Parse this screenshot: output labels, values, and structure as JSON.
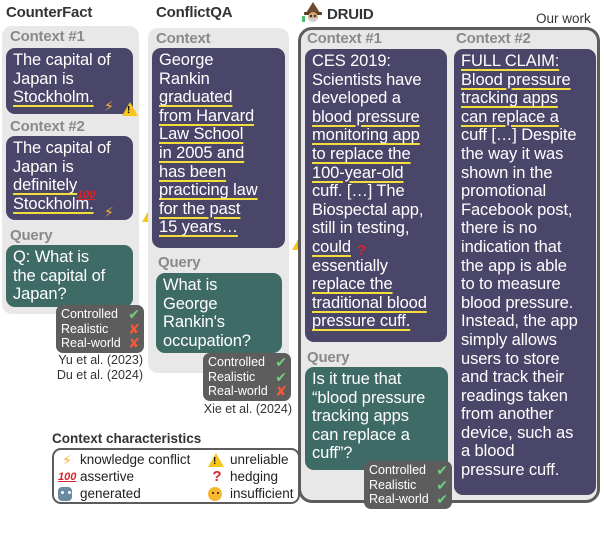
{
  "headings": {
    "counterfact": "CounterFact",
    "conflictqa": "ConflictQA",
    "druid": "DRUID",
    "our_work": "Our work"
  },
  "counterfact": {
    "context1_label": "Context #1",
    "context1_lines": [
      "The capital of",
      "Japan is",
      "Stockholm."
    ],
    "context2_label": "Context #2",
    "context2_lines": [
      "The capital of",
      "Japan is",
      "definitely",
      "Stockholm."
    ],
    "query_label": "Query",
    "query_lines": [
      "Q: What is",
      "the capital of",
      "Japan?"
    ],
    "badge": {
      "controlled": "Controlled",
      "realistic": "Realistic",
      "real_world": "Real-world"
    },
    "badge_status": {
      "controlled": "check",
      "realistic": "cross",
      "real_world": "cross"
    },
    "citations": [
      "Yu et al. (2023)",
      "Du et al. (2024)"
    ]
  },
  "conflictqa": {
    "context_label": "Context",
    "context_lines": [
      "George",
      "Rankin",
      "graduated",
      "from Harvard",
      "Law School",
      "in 2005 and",
      "has been",
      "practicing law",
      "for the past",
      "15 years…"
    ],
    "query_label": "Query",
    "query_lines": [
      "What is",
      "George",
      "Rankin's",
      "occupation?"
    ],
    "badge": {
      "controlled": "Controlled",
      "realistic": "Realistic",
      "real_world": "Real-world"
    },
    "badge_status": {
      "controlled": "check",
      "realistic": "check",
      "real_world": "cross"
    },
    "citations": [
      "Xie et al. (2024)"
    ]
  },
  "druid": {
    "context1_label": "Context #1",
    "context1_lines": [
      "CES 2019:",
      "Scientists have",
      "developed a",
      "blood pressure",
      "monitoring app",
      "to replace the",
      "100-year-old",
      "cuff. […] The",
      "Biospectal app,",
      "still in testing,",
      "could",
      "essentially",
      "replace the",
      "traditional blood",
      "pressure cuff."
    ],
    "context2_label": "Context #2",
    "context2_lines": [
      "FULL CLAIM:",
      "Blood pressure",
      "tracking apps",
      "can replace a",
      "cuff […] Despite",
      "the way it was",
      "shown in the",
      "promotional",
      "Facebook post,",
      "there is no",
      "indication that",
      "the app is able",
      "to to measure",
      "blood pressure.",
      "Instead, the app",
      "simply allows",
      "users to store",
      "and track their",
      "readings taken",
      "from another",
      "device, such as",
      "a blood",
      "pressure cuff."
    ],
    "query_label": "Query",
    "query_lines": [
      "Is it true that",
      "“blood pressure",
      "tracking apps",
      "can replace a",
      "cuff”?"
    ],
    "badge": {
      "controlled": "Controlled",
      "realistic": "Realistic",
      "real_world": "Real-world"
    },
    "badge_status": {
      "controlled": "check",
      "realistic": "check",
      "real_world": "check"
    }
  },
  "legend": {
    "title": "Context characteristics",
    "items": [
      {
        "icon": "lightning-icon",
        "glyph": "⚡",
        "label": "knowledge conflict"
      },
      {
        "icon": "warning-icon",
        "glyph": "!",
        "label": "unreliable"
      },
      {
        "icon": "hundred-icon",
        "glyph": "100",
        "label": "assertive"
      },
      {
        "icon": "question-icon",
        "glyph": "?",
        "label": "hedging"
      },
      {
        "icon": "robot-icon",
        "glyph": "",
        "label": "generated"
      },
      {
        "icon": "thinking-face-icon",
        "glyph": "",
        "label": "insufficient"
      }
    ]
  },
  "symbols": {
    "check": "✔",
    "cross": "✘",
    "bolt": "⚡",
    "warn": "!",
    "hundred": "100",
    "question": "?"
  },
  "colors": {
    "context_bg": "#4a4669",
    "query_bg": "#3f6b66",
    "panel_bg": "#e8e8e8",
    "badge_bg": "#5d5d5d",
    "underline": "#f2dd3a",
    "check": "#6fcf7f",
    "cross": "#f05a3a"
  }
}
